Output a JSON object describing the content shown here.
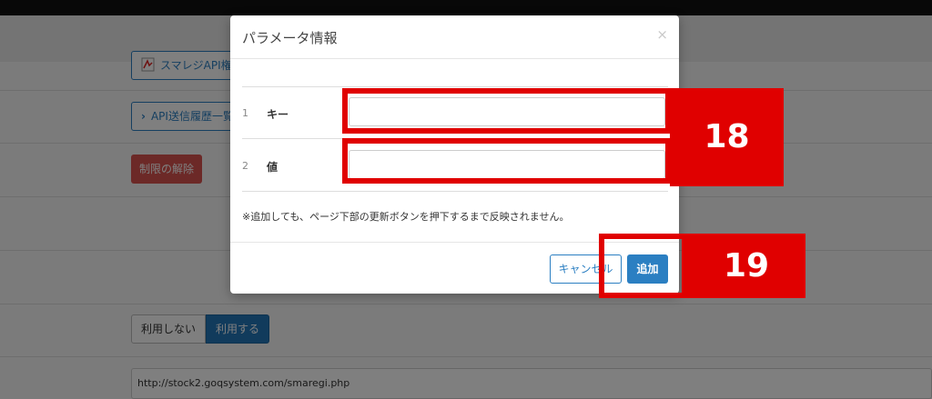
{
  "background": {
    "smaregi_api_button": "スマレジAPI権",
    "api_history_button": "API送信履歴一覧",
    "unlock_button": "制限の解除",
    "use_toggle": {
      "off_label": "利用しない",
      "on_label": "利用する",
      "selected": "利用する"
    },
    "endpoint_url": "http://stock2.goqsystem.com/smaregi.php"
  },
  "modal": {
    "title": "パラメータ情報",
    "close_symbol": "×",
    "rows": [
      {
        "index": "1",
        "label": "キー",
        "value": ""
      },
      {
        "index": "2",
        "label": "値",
        "value": ""
      }
    ],
    "note": "※追加しても、ページ下部の更新ボタンを押下するまで反映されません。",
    "cancel_label": "キャンセル",
    "add_label": "追加"
  },
  "annotations": {
    "step_inputs": "18",
    "step_add": "19",
    "color": "#e00000"
  },
  "colors": {
    "primary": "#2b7fc2",
    "danger": "#d9534f"
  }
}
